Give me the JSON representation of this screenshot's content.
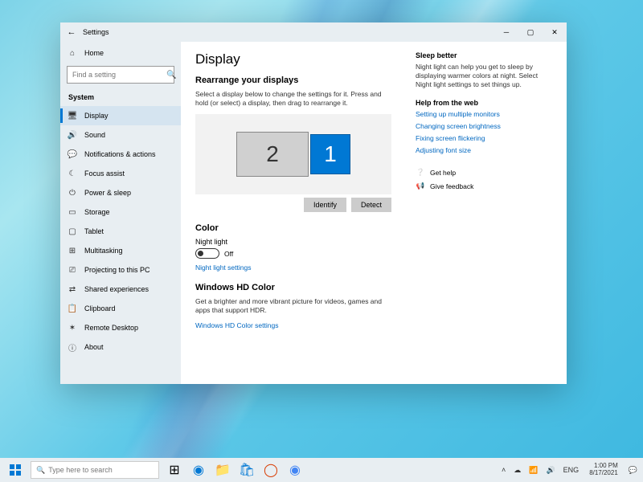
{
  "window": {
    "title": "Settings",
    "minimize": "─",
    "maximize": "▢",
    "close": "✕"
  },
  "sidebar": {
    "home": "Home",
    "search_placeholder": "Find a setting",
    "category": "System",
    "items": [
      {
        "icon": "display",
        "label": "Display"
      },
      {
        "icon": "sound",
        "label": "Sound"
      },
      {
        "icon": "notif",
        "label": "Notifications & actions"
      },
      {
        "icon": "focus",
        "label": "Focus assist"
      },
      {
        "icon": "power",
        "label": "Power & sleep"
      },
      {
        "icon": "storage",
        "label": "Storage"
      },
      {
        "icon": "tablet",
        "label": "Tablet"
      },
      {
        "icon": "multi",
        "label": "Multitasking"
      },
      {
        "icon": "project",
        "label": "Projecting to this PC"
      },
      {
        "icon": "shared",
        "label": "Shared experiences"
      },
      {
        "icon": "clip",
        "label": "Clipboard"
      },
      {
        "icon": "remote",
        "label": "Remote Desktop"
      },
      {
        "icon": "about",
        "label": "About"
      }
    ]
  },
  "main": {
    "heading": "Display",
    "rearrange_heading": "Rearrange your displays",
    "rearrange_desc": "Select a display below to change the settings for it. Press and hold (or select) a display, then drag to rearrange it.",
    "monitors": {
      "m1": "1",
      "m2": "2"
    },
    "identify": "Identify",
    "detect": "Detect",
    "color_heading": "Color",
    "night_light_label": "Night light",
    "night_light_state": "Off",
    "night_light_settings": "Night light settings",
    "hd_heading": "Windows HD Color",
    "hd_desc": "Get a brighter and more vibrant picture for videos, games and apps that support HDR.",
    "hd_link": "Windows HD Color settings"
  },
  "aside": {
    "sleep_heading": "Sleep better",
    "sleep_desc": "Night light can help you get to sleep by displaying warmer colors at night. Select Night light settings to set things up.",
    "help_heading": "Help from the web",
    "help_links": [
      "Setting up multiple monitors",
      "Changing screen brightness",
      "Fixing screen flickering",
      "Adjusting font size"
    ],
    "get_help": "Get help",
    "feedback": "Give feedback"
  },
  "taskbar": {
    "search_placeholder": "Type here to search",
    "lang": "ENG",
    "time": "1:00 PM",
    "date": "8/17/2021"
  }
}
